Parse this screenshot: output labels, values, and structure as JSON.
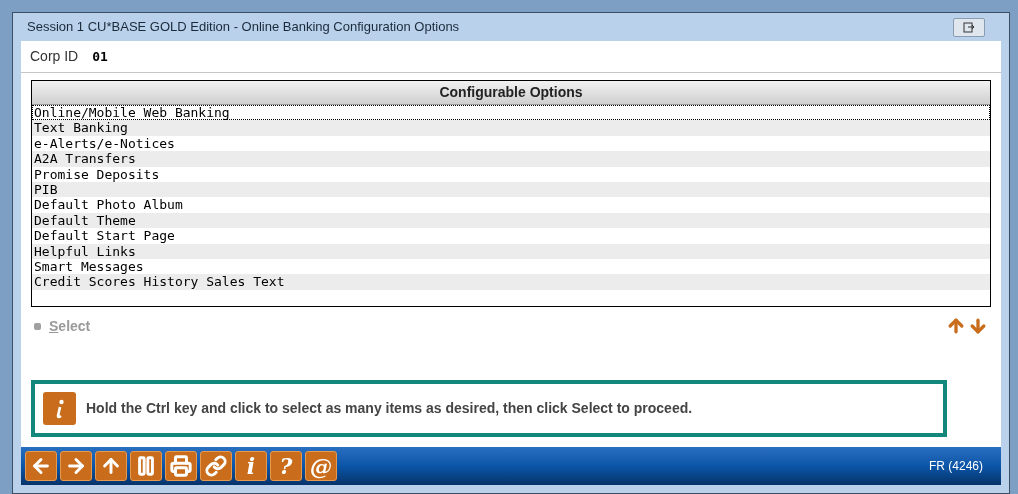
{
  "window": {
    "title": "Session 1 CU*BASE GOLD Edition - Online Banking Configuration Options"
  },
  "corp_id": {
    "label": "Corp ID",
    "value": "01"
  },
  "table": {
    "heading": "Configurable Options",
    "rows": [
      {
        "label": "Online/Mobile Web Banking",
        "focused": true
      },
      {
        "label": "Text Banking",
        "focused": false
      },
      {
        "label": "e-Alerts/e-Notices",
        "focused": false
      },
      {
        "label": "A2A Transfers",
        "focused": false
      },
      {
        "label": "Promise Deposits",
        "focused": false
      },
      {
        "label": "PIB",
        "focused": false
      },
      {
        "label": "Default Photo Album",
        "focused": false
      },
      {
        "label": "Default Theme",
        "focused": false
      },
      {
        "label": "Default Start Page",
        "focused": false
      },
      {
        "label": "Helpful Links",
        "focused": false
      },
      {
        "label": "Smart Messages",
        "focused": false
      },
      {
        "label": "Credit Scores History Sales Text",
        "focused": false
      }
    ]
  },
  "select_action": {
    "label": "Select",
    "disabled": true
  },
  "info": {
    "message": "Hold the Ctrl key and click to select as many items as desired, then click Select to proceed."
  },
  "toolbar": [
    {
      "kind": "back"
    },
    {
      "kind": "forward"
    },
    {
      "kind": "up"
    },
    {
      "kind": "pause"
    },
    {
      "kind": "print"
    },
    {
      "kind": "link"
    },
    {
      "kind": "text",
      "label": "i"
    },
    {
      "kind": "text",
      "label": "?"
    },
    {
      "kind": "text",
      "label": "@"
    }
  ],
  "status_bar": {
    "code": "FR (4246)"
  }
}
